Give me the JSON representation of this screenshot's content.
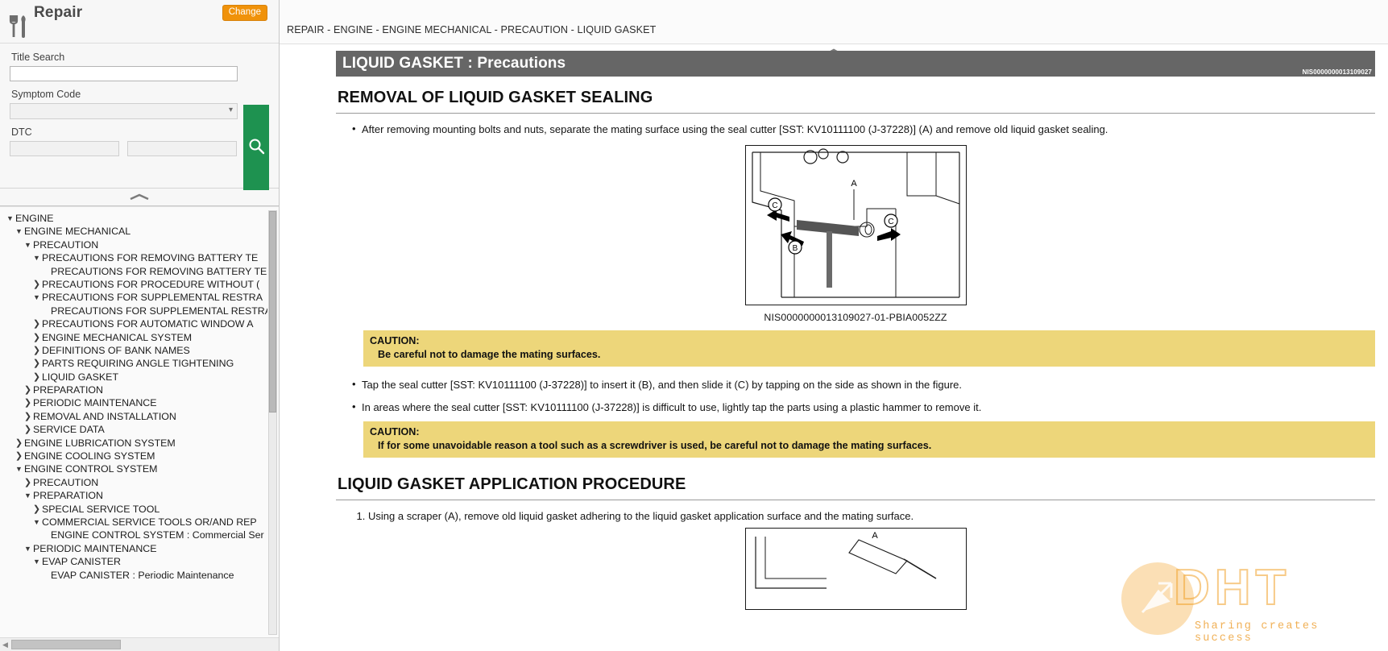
{
  "sidebar": {
    "title": "Repair",
    "tool_icon": "wrench-screwdriver-icon",
    "change_button": "Change",
    "search": {
      "title_search_label": "Title Search",
      "title_search_value": "",
      "title_search_placeholder": "",
      "symptom_code_label": "Symptom Code",
      "symptom_code_value": "",
      "dtc_label": "DTC",
      "dtc_value_1": "",
      "dtc_value_2": "",
      "search_icon": "search-icon"
    },
    "collapse_icon": "chevron-up-icon",
    "scroll": {
      "left_arrow": "◀"
    },
    "tree": [
      {
        "label": "ENGINE",
        "indent": 0,
        "state": "expanded"
      },
      {
        "label": "ENGINE MECHANICAL",
        "indent": 1,
        "state": "expanded"
      },
      {
        "label": "PRECAUTION",
        "indent": 2,
        "state": "expanded"
      },
      {
        "label": "PRECAUTIONS FOR REMOVING BATTERY TE",
        "indent": 3,
        "state": "expanded"
      },
      {
        "label": "PRECAUTIONS FOR REMOVING BATTERY TER",
        "indent": 4,
        "state": "leaf"
      },
      {
        "label": "PRECAUTIONS FOR PROCEDURE WITHOUT (",
        "indent": 3,
        "state": "collapsed"
      },
      {
        "label": "PRECAUTIONS FOR SUPPLEMENTAL RESTRA",
        "indent": 3,
        "state": "expanded"
      },
      {
        "label": "PRECAUTIONS FOR SUPPLEMENTAL RESTRAI",
        "indent": 4,
        "state": "leaf"
      },
      {
        "label": "PRECAUTIONS FOR AUTOMATIC WINDOW A",
        "indent": 3,
        "state": "collapsed"
      },
      {
        "label": "ENGINE MECHANICAL SYSTEM",
        "indent": 3,
        "state": "collapsed"
      },
      {
        "label": "DEFINITIONS OF BANK NAMES",
        "indent": 3,
        "state": "collapsed"
      },
      {
        "label": "PARTS REQUIRING ANGLE TIGHTENING",
        "indent": 3,
        "state": "collapsed"
      },
      {
        "label": "LIQUID GASKET",
        "indent": 3,
        "state": "collapsed"
      },
      {
        "label": "PREPARATION",
        "indent": 2,
        "state": "collapsed"
      },
      {
        "label": "PERIODIC MAINTENANCE",
        "indent": 2,
        "state": "collapsed"
      },
      {
        "label": "REMOVAL AND INSTALLATION",
        "indent": 2,
        "state": "collapsed"
      },
      {
        "label": "SERVICE DATA",
        "indent": 2,
        "state": "collapsed"
      },
      {
        "label": "ENGINE LUBRICATION SYSTEM",
        "indent": 1,
        "state": "collapsed"
      },
      {
        "label": "ENGINE COOLING SYSTEM",
        "indent": 1,
        "state": "collapsed"
      },
      {
        "label": "ENGINE CONTROL SYSTEM",
        "indent": 1,
        "state": "expanded"
      },
      {
        "label": "PRECAUTION",
        "indent": 2,
        "state": "collapsed"
      },
      {
        "label": "PREPARATION",
        "indent": 2,
        "state": "expanded"
      },
      {
        "label": "SPECIAL SERVICE TOOL",
        "indent": 3,
        "state": "collapsed"
      },
      {
        "label": "COMMERCIAL SERVICE TOOLS OR/AND REP",
        "indent": 3,
        "state": "expanded"
      },
      {
        "label": "ENGINE CONTROL SYSTEM : Commercial Ser",
        "indent": 4,
        "state": "leaf"
      },
      {
        "label": "PERIODIC MAINTENANCE",
        "indent": 2,
        "state": "expanded"
      },
      {
        "label": "EVAP CANISTER",
        "indent": 3,
        "state": "expanded"
      },
      {
        "label": "EVAP CANISTER : Periodic Maintenance",
        "indent": 4,
        "state": "leaf"
      }
    ]
  },
  "main": {
    "breadcrumb": "REPAIR - ENGINE - ENGINE MECHANICAL - PRECAUTION - LIQUID GASKET",
    "collapse_icon": "chevron-up-icon",
    "doc_title": "LIQUID GASKET : Precautions",
    "doc_id": "NIS0000000013109027",
    "section1": {
      "heading": "REMOVAL OF LIQUID GASKET SEALING",
      "bullet1": "After removing mounting bolts and nuts, separate the mating surface using the seal cutter [SST: KV10111100 (J-37228)] (A) and remove old liquid gasket sealing.",
      "figure_caption": "NIS0000000013109027-01-PBIA0052ZZ",
      "caution1_head": "CAUTION:",
      "caution1_body": "Be careful not to damage the mating surfaces.",
      "bullet2": "Tap the seal cutter [SST: KV10111100 (J-37228)] to insert it (B), and then slide it (C) by tapping on the side as shown in the figure.",
      "bullet3": "In areas where the seal cutter [SST: KV10111100 (J-37228)] is difficult to use, lightly tap the parts using a plastic hammer to remove it.",
      "caution2_head": "CAUTION:",
      "caution2_body": "If for some unavoidable reason a tool such as a screwdriver is used, be careful not to damage the mating surfaces."
    },
    "section2": {
      "heading": "LIQUID GASKET APPLICATION PROCEDURE",
      "step1": "Using a scraper (A), remove old liquid gasket adhering to the liquid gasket application surface and the mating surface."
    },
    "figure_labels": {
      "a": "A",
      "b": "B",
      "c": "C"
    }
  },
  "watermark": {
    "text": "DHT",
    "tagline": "Sharing creates success",
    "logo_icon": "arrow-circle-icon"
  },
  "colors": {
    "accent_orange": "#f0920a",
    "search_green": "#1e9250",
    "title_bar_gray": "#666666",
    "caution_yellow": "#edd67a"
  }
}
